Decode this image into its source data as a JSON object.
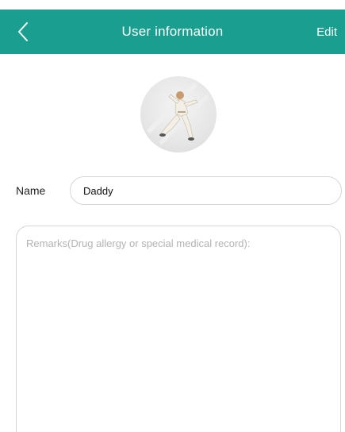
{
  "header": {
    "title": "User information",
    "edit_label": "Edit",
    "back_icon": "chevron-left-icon",
    "background_color": "#1a9e8f"
  },
  "profile": {
    "avatar_description_icon": "avatar-icon"
  },
  "form": {
    "name_label": "Name",
    "name_value": "Daddy",
    "remarks_placeholder": "Remarks(Drug allergy or special medical record):",
    "remarks_value": ""
  }
}
